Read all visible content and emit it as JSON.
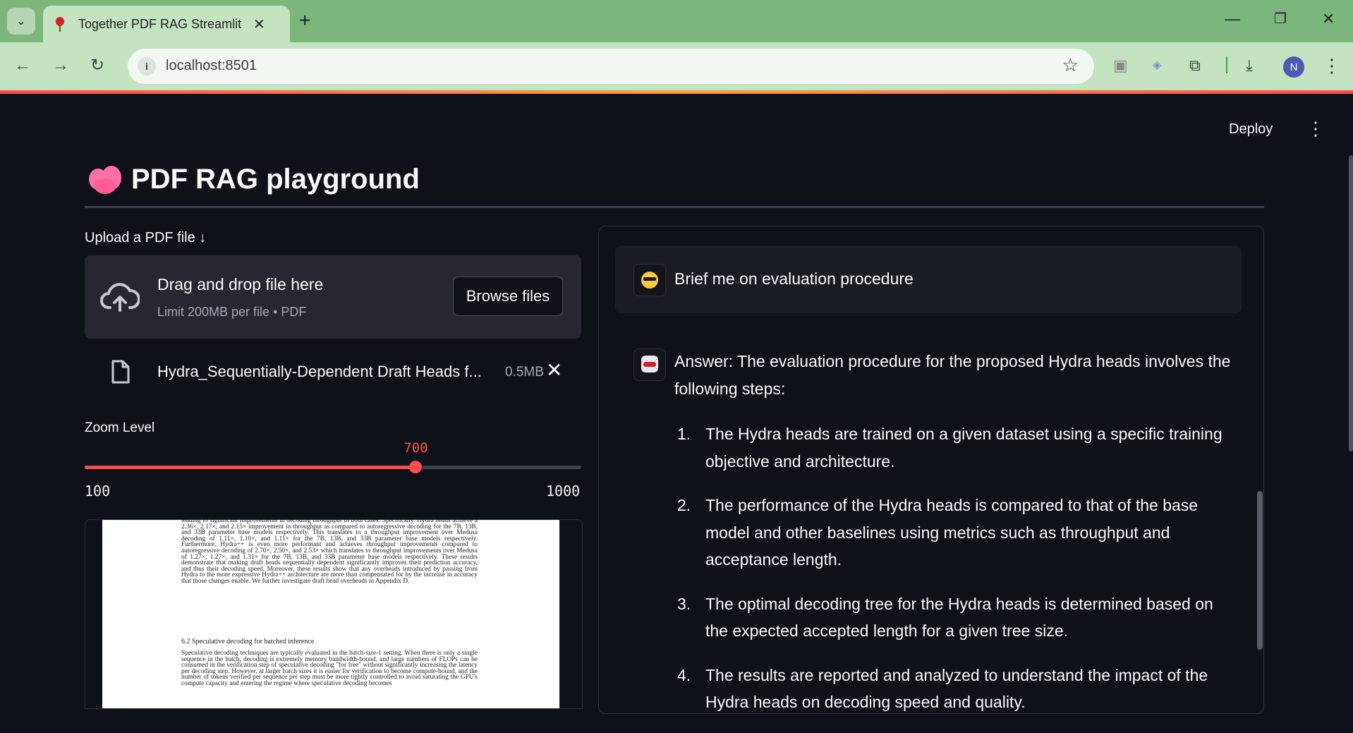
{
  "browser": {
    "tab_title": "Together PDF RAG Streamlit UI",
    "url": "localhost:8501",
    "profile_initial": "N",
    "icons": [
      "tab-search-icon",
      "favicon-balloon-icon",
      "tab-close-icon",
      "new-tab-icon",
      "minimize-icon",
      "restore-icon",
      "close-window-icon",
      "back-icon",
      "forward-icon",
      "reload-icon",
      "site-info-icon",
      "bookmark-star-icon",
      "extension-1-icon",
      "extension-2-icon",
      "extensions-puzzle-icon",
      "download-icon",
      "chrome-menu-icon"
    ]
  },
  "app": {
    "deploy_label": "Deploy",
    "title": "PDF RAG playground",
    "title_icon": "brain-emoji"
  },
  "uploader": {
    "label": "Upload a PDF file ↓",
    "drop_title": "Drag and drop file here",
    "drop_sub": "Limit 200MB per file • PDF",
    "browse_label": "Browse files",
    "file_name": "Hydra_Sequentially-Dependent Draft Heads f...",
    "file_size": "0.5MB"
  },
  "zoom": {
    "label": "Zoom Level",
    "value": 700,
    "value_text": "700",
    "min": 100,
    "min_text": "100",
    "max": 1000,
    "max_text": "1000"
  },
  "pdf_preview": {
    "paragraph_1": "leading to significant improvements in decoding throughput in both cases. Specifically, Hydra heads achieve a 2.36×, 2.17×, and 2.15× improvement in throughput as compared to autoregressive decoding for the 7B, 13B, and 33B parameter base models respectively. This translates to a throughput improvement over Medusa decoding of 1.11×, 1.10×, and 1.11× for the 7B, 13B, and 33B parameter base models respectively. Furthermore, Hydra++ is even more performant and achieves throughput improvements compared to autoregressive decoding of 2.70×, 2.50×, and 2.53× which translates to throughput improvements over Medusa of 1.27×, 1.27×, and 1.31× for the 7B, 13B, and 33B parameter base models respectively. These results demonstrate that making draft heads sequentially dependent significantly improves their prediction accuracy, and thus their decoding speed. Moreover, these results show that any overheads introduced by passing from Hydra to the more expressive Hydra++ architecture are more than compensated for by the increase in accuracy that those changes enable. We further investigate draft head overheads in Appendix D.",
    "section_heading": "6.2    Speculative decoding for batched inference",
    "paragraph_2": "Speculative decoding techniques are typically evaluated in the batch-size-1 setting. When there is only a single sequence in the batch, decoding is extremely memory bandwidth-bound, and large numbers of FLOPs can be consumed in the verification step of speculative decoding \"for free\" without significantly increasing the latency per decoding step. However, at larger batch sizes it is easier for verification to become compute-bound, and the number of tokens verified per sequence per step must be more tightly controlled to avoid saturating the GPU's compute capacity and entering the regime where speculative decoding becomes"
  },
  "chat": {
    "user_message": "Brief me on evaluation procedure",
    "answer_intro": "Answer: The evaluation procedure for the proposed Hydra heads involves the following steps:",
    "steps": [
      {
        "num": "1.",
        "text": "The Hydra heads are trained on a given dataset using a specific training objective and architecture."
      },
      {
        "num": "2.",
        "text": "The performance of the Hydra heads is compared to that of the base model and other baselines using metrics such as throughput and acceptance length."
      },
      {
        "num": "3.",
        "text": "The optimal decoding tree for the Hydra heads is determined based on the expected accepted length for a given tree size."
      },
      {
        "num": "4.",
        "text": "The results are reported and analyzed to understand the impact of the Hydra heads on decoding speed and quality."
      }
    ]
  },
  "colors": {
    "accent": "#ff4b4b",
    "background": "#0e1117",
    "surface": "#262730",
    "chrome_tab_bar": "#7db67d",
    "chrome_toolbar": "#c3e3c1"
  }
}
